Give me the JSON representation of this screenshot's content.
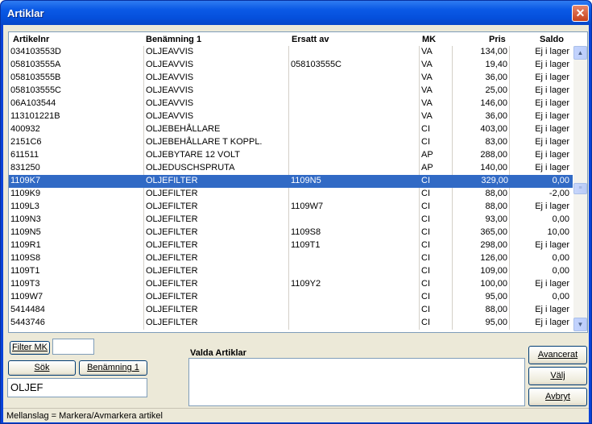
{
  "window": {
    "title": "Artiklar",
    "close_glyph": "✕"
  },
  "columns": {
    "artikelnr": "Artikelnr",
    "benamning": "Benämning 1",
    "ersatt": "Ersatt av",
    "mk": "MK",
    "pris": "Pris",
    "saldo": "Saldo"
  },
  "rows": [
    {
      "artikelnr": "034103553D",
      "benamning": "OLJEAVVIS",
      "ersatt": "",
      "mk": "VA",
      "pris": "134,00",
      "saldo": "Ej i lager"
    },
    {
      "artikelnr": "058103555A",
      "benamning": "OLJEAVVIS",
      "ersatt": "058103555C",
      "mk": "VA",
      "pris": "19,40",
      "saldo": "Ej i lager"
    },
    {
      "artikelnr": "058103555B",
      "benamning": "OLJEAVVIS",
      "ersatt": "",
      "mk": "VA",
      "pris": "36,00",
      "saldo": "Ej i lager"
    },
    {
      "artikelnr": "058103555C",
      "benamning": "OLJEAVVIS",
      "ersatt": "",
      "mk": "VA",
      "pris": "25,00",
      "saldo": "Ej i lager"
    },
    {
      "artikelnr": "06A103544",
      "benamning": "OLJEAVVIS",
      "ersatt": "",
      "mk": "VA",
      "pris": "146,00",
      "saldo": "Ej i lager"
    },
    {
      "artikelnr": "113101221B",
      "benamning": "OLJEAVVIS",
      "ersatt": "",
      "mk": "VA",
      "pris": "36,00",
      "saldo": "Ej i lager"
    },
    {
      "artikelnr": "400932",
      "benamning": "OLJEBEHÅLLARE",
      "ersatt": "",
      "mk": "CI",
      "pris": "403,00",
      "saldo": "Ej i lager"
    },
    {
      "artikelnr": "2151C6",
      "benamning": "OLJEBEHÅLLARE T KOPPL.",
      "ersatt": "",
      "mk": "CI",
      "pris": "83,00",
      "saldo": "Ej i lager"
    },
    {
      "artikelnr": "611511",
      "benamning": "OLJEBYTARE 12 VOLT",
      "ersatt": "",
      "mk": "AP",
      "pris": "288,00",
      "saldo": "Ej i lager"
    },
    {
      "artikelnr": "831250",
      "benamning": "OLJEDUSCHSPRUTA",
      "ersatt": "",
      "mk": "AP",
      "pris": "140,00",
      "saldo": "Ej i lager"
    },
    {
      "artikelnr": "1109K7",
      "benamning": "OLJEFILTER",
      "ersatt": "1109N5",
      "mk": "CI",
      "pris": "329,00",
      "saldo": "0,00",
      "selected": true
    },
    {
      "artikelnr": "1109K9",
      "benamning": "OLJEFILTER",
      "ersatt": "",
      "mk": "CI",
      "pris": "88,00",
      "saldo": "-2,00"
    },
    {
      "artikelnr": "1109L3",
      "benamning": "OLJEFILTER",
      "ersatt": "1109W7",
      "mk": "CI",
      "pris": "88,00",
      "saldo": "Ej i lager"
    },
    {
      "artikelnr": "1109N3",
      "benamning": "OLJEFILTER",
      "ersatt": "",
      "mk": "CI",
      "pris": "93,00",
      "saldo": "0,00"
    },
    {
      "artikelnr": "1109N5",
      "benamning": "OLJEFILTER",
      "ersatt": "1109S8",
      "mk": "CI",
      "pris": "365,00",
      "saldo": "10,00"
    },
    {
      "artikelnr": "1109R1",
      "benamning": "OLJEFILTER",
      "ersatt": "1109T1",
      "mk": "CI",
      "pris": "298,00",
      "saldo": "Ej i lager"
    },
    {
      "artikelnr": "1109S8",
      "benamning": "OLJEFILTER",
      "ersatt": "",
      "mk": "CI",
      "pris": "126,00",
      "saldo": "0,00"
    },
    {
      "artikelnr": "1109T1",
      "benamning": "OLJEFILTER",
      "ersatt": "",
      "mk": "CI",
      "pris": "109,00",
      "saldo": "0,00"
    },
    {
      "artikelnr": "1109T3",
      "benamning": "OLJEFILTER",
      "ersatt": "1109Y2",
      "mk": "CI",
      "pris": "100,00",
      "saldo": "Ej i lager"
    },
    {
      "artikelnr": "1109W7",
      "benamning": "OLJEFILTER",
      "ersatt": "",
      "mk": "CI",
      "pris": "95,00",
      "saldo": "0,00"
    },
    {
      "artikelnr": "5414484",
      "benamning": "OLJEFILTER",
      "ersatt": "",
      "mk": "CI",
      "pris": "88,00",
      "saldo": "Ej i lager"
    },
    {
      "artikelnr": "5443746",
      "benamning": "OLJEFILTER",
      "ersatt": "",
      "mk": "CI",
      "pris": "95,00",
      "saldo": "Ej i lager"
    }
  ],
  "scrollbar": {
    "up_glyph": "▲",
    "down_glyph": "▼",
    "thumb_glyph": "≡"
  },
  "filter": {
    "filter_mk_label": "Filter MK",
    "filter_mk_value": "",
    "sok_label": "Sök",
    "benamning_label": "Benämning 1",
    "search_value": "OLJEF"
  },
  "valda": {
    "label": "Valda Artiklar"
  },
  "actions": {
    "avancerat_label": "Avancerat",
    "valj_label": "Välj",
    "avbryt_label": "Avbryt"
  },
  "status": {
    "text": "Mellanslag = Markera/Avmarkera artikel"
  },
  "colors": {
    "titlebar": "#0b5ae6",
    "selection": "#316ac5",
    "dialog_bg": "#ece9d8",
    "close_button": "#c6411b"
  }
}
